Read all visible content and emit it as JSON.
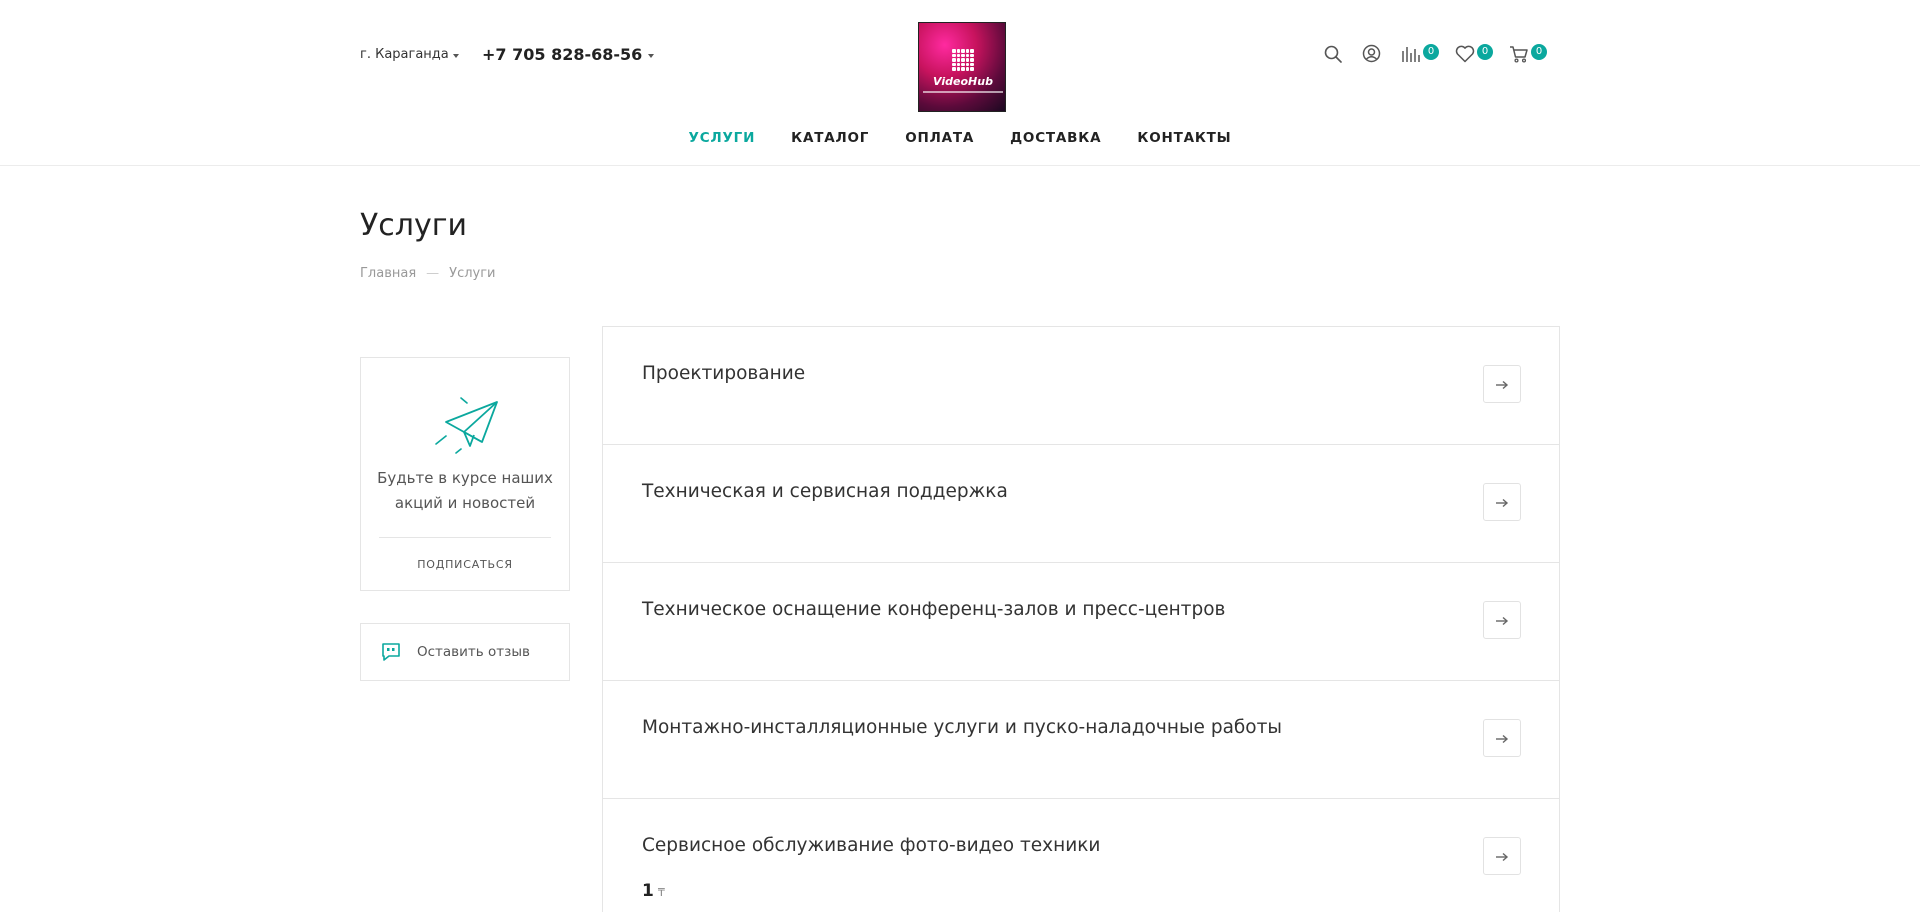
{
  "header": {
    "city": "г. Караганда",
    "phone": "+7 705 828-68-56",
    "logo_text": "VideoHub",
    "counters": {
      "compare": "0",
      "favorites": "0",
      "cart": "0"
    },
    "accent_color": "#0ba89e"
  },
  "nav": {
    "items": [
      "УСЛУГИ",
      "КАТАЛОГ",
      "ОПЛАТА",
      "ДОСТАВКА",
      "КОНТАКТЫ"
    ],
    "active": "УСЛУГИ"
  },
  "page": {
    "title": "Услуги",
    "breadcrumb": {
      "home": "Главная",
      "separator": "—",
      "current": "Услуги"
    }
  },
  "sidebar": {
    "subscribe_text": "Будьте в курсе наших акций и новостей",
    "subscribe_button": "ПОДПИСАТЬСЯ",
    "review_label": "Оставить отзыв"
  },
  "services": [
    {
      "title": "Проектирование"
    },
    {
      "title": "Техническая и сервисная поддержка"
    },
    {
      "title": "Техническое оснащение конференц-залов и пресс-центров"
    },
    {
      "title": "Монтажно-инсталляционные услуги и пуско-наладочные работы"
    },
    {
      "title": "Сервисное обслуживание фото-видео техники",
      "price": "1",
      "currency": "₸"
    }
  ]
}
